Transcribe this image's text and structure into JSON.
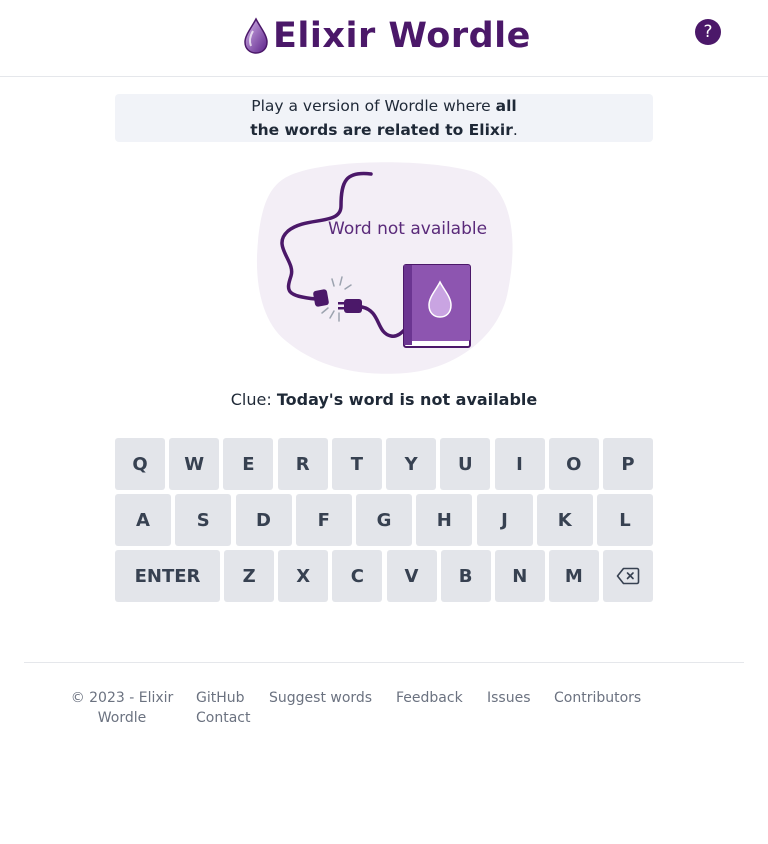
{
  "header": {
    "title": "Elixir Wordle",
    "help_label": "?"
  },
  "intro": {
    "text_before": "Play a version of Wordle where ",
    "text_bold": "all the words are related to Elixir",
    "text_after": "."
  },
  "status": {
    "message": "Word not available"
  },
  "clue": {
    "label": "Clue: ",
    "value": "Today's word is not available"
  },
  "keyboard": {
    "row1": [
      "Q",
      "W",
      "E",
      "R",
      "T",
      "Y",
      "U",
      "I",
      "O",
      "P"
    ],
    "row2": [
      "A",
      "S",
      "D",
      "F",
      "G",
      "H",
      "J",
      "K",
      "L"
    ],
    "row3": [
      "ENTER",
      "Z",
      "X",
      "C",
      "V",
      "B",
      "N",
      "M"
    ],
    "backspace_icon": "backspace-icon"
  },
  "footer": {
    "copyright": "© 2023 - Elixir Wordle",
    "links": [
      "GitHub",
      "Suggest words",
      "Feedback",
      "Issues",
      "Contributors",
      "Contact"
    ]
  },
  "colors": {
    "brand": "#4b1869",
    "key_bg": "#e3e5ea",
    "intro_bg": "#f1f3f8",
    "illustration_bg": "#f3eef6"
  }
}
